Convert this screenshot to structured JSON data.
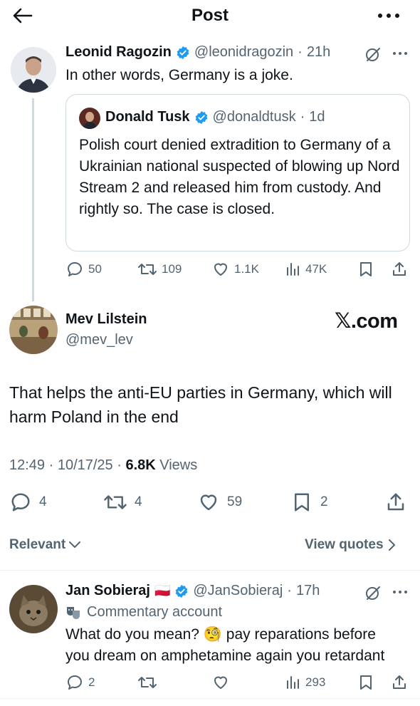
{
  "header": {
    "title": "Post"
  },
  "post1": {
    "name": "Leonid Ragozin",
    "handle": "@leonidragozin",
    "time": "21h",
    "text": "In other words, Germany is a joke.",
    "quote": {
      "name": "Donald Tusk",
      "handle": "@donaldtusk",
      "time": "1d",
      "text": "Polish court denied extradition to Germany of a Ukrainian national suspected of blowing up Nord Stream 2 and released him from custody. And rightly so. The case is closed."
    },
    "metrics": {
      "replies": "50",
      "reposts": "109",
      "likes": "1.1K",
      "views": "47K"
    }
  },
  "main_post": {
    "name": "Mev Lilstein",
    "handle": "@mev_lev",
    "brand": "𝕏.com",
    "text": "That helps the anti-EU parties in Germany, which will harm Poland in the end",
    "timestamp": "12:49 · 10/17/25 · ",
    "views_count": "6.8K",
    "views_label": " Views",
    "metrics": {
      "replies": "4",
      "reposts": "4",
      "likes": "59",
      "bookmarks": "2"
    }
  },
  "filters": {
    "relevant": "Relevant",
    "view_quotes": "View quotes"
  },
  "reply": {
    "name": "Jan Sobieraj",
    "flag": "🇵🇱",
    "handle": "@JanSobieraj",
    "time": "17h",
    "label": "Commentary account",
    "text_line1": "What do you mean? 🧐 pay reparations before",
    "text_line2": "you dream on amphetamine again you retardant",
    "metrics": {
      "replies": "2",
      "views": "293"
    }
  },
  "colors": {
    "verified": "#1d9bf0",
    "gray": "#536471",
    "thread_line": "#cfd9de"
  }
}
